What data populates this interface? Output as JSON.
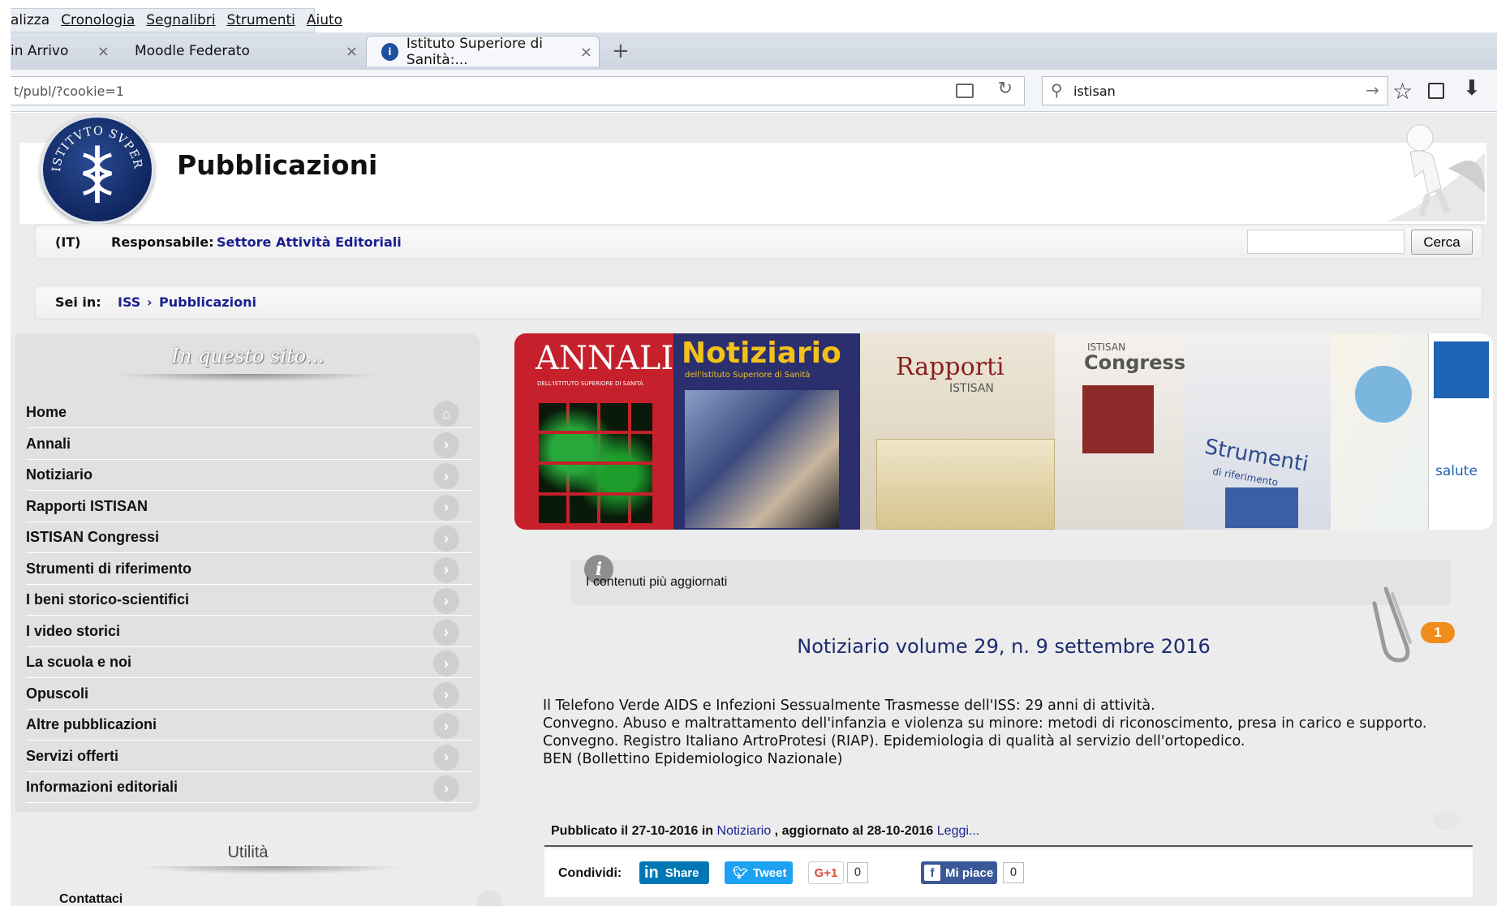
{
  "menu": {
    "items": [
      "alizza",
      "Cronologia",
      "Segnalibri",
      "Strumenti",
      "Aiuto"
    ]
  },
  "tabs": [
    {
      "label": "in Arrivo"
    },
    {
      "label": "Moodle Federato"
    },
    {
      "label": "Istituto Superiore di Sanità:..."
    }
  ],
  "tab_close": "×",
  "tab_new": "+",
  "address": {
    "url": "t/publ/?cookie=1"
  },
  "search": {
    "value": "istisan"
  },
  "site": {
    "title": "Pubblicazioni",
    "logo_text": "ISTITVTO SVPERIORE DI SANITA",
    "lang": "(IT)",
    "responsabile_label": "Responsabile:",
    "responsabile_link": "Settore Attività Editoriali",
    "search_button": "Cerca",
    "breadcrumb_label": "Sei in:",
    "breadcrumb_iss": "ISS",
    "breadcrumb_sep": "›",
    "breadcrumb_current": "Pubblicazioni"
  },
  "sidebar": {
    "title": "In questo sito...",
    "items": [
      "Home",
      "Annali",
      "Notiziario",
      "Rapporti ISTISAN",
      "ISTISAN Congressi",
      "Strumenti di riferimento",
      "I beni storico-scientifici",
      "I video storici",
      "La scuola e noi",
      "Opuscoli",
      "Altre pubblicazioni",
      "Servizi offerti",
      "Informazioni editoriali"
    ],
    "utility_title": "Utilità",
    "utility_first": "Contattaci"
  },
  "banner": {
    "annali": "ANNALI",
    "annali_sub": "DELL'ISTITUTO SUPERIORE DI SANITÀ",
    "notiziario": "Notiziario",
    "notiziario_sub": "dell'Istituto Superiore di Sanità",
    "rapporti": "Rapporti",
    "rapporti_sub": "ISTISAN",
    "congressi_sub": "ISTISAN",
    "congressi": "Congressi",
    "strumenti": "Strumenti",
    "strumenti_sub": "di riferimento",
    "salute": "salute"
  },
  "news": {
    "section_label": "I contenuti più aggiornati",
    "badge": "1",
    "title": "Notiziario volume 29, n. 9 settembre 2016",
    "lines": [
      "Il Telefono Verde AIDS e Infezioni Sessualmente Trasmesse dell'ISS: 29 anni di attività.",
      "Convegno. Abuso e maltrattamento dell'infanzia e violenza su minore: metodi di riconoscimento, presa in carico e supporto.",
      "Convegno. Registro Italiano ArtroProtesi (RIAP). Epidemiologia di qualità al servizio dell'ortopedico.",
      "BEN (Bollettino Epidemiologico Nazionale)"
    ],
    "published_prefix": "Pubblicato il 27-10-2016 in",
    "published_section": "Notiziario",
    "updated": ", aggiornato al 28-10-2016",
    "read_more": "Leggi..."
  },
  "share": {
    "label": "Condividi:",
    "linkedin": "Share",
    "twitter": "Tweet",
    "gplus": "G+1",
    "gplus_count": "0",
    "facebook": "Mi piace",
    "facebook_count": "0"
  },
  "colors": {
    "link": "#1a1f8f",
    "title_blue": "#1a2a6e",
    "badge": "#f08c1a",
    "linkedin": "#0077b5",
    "twitter": "#1da1f2",
    "facebook": "#3b5998",
    "gplus": "#dd4b39"
  }
}
